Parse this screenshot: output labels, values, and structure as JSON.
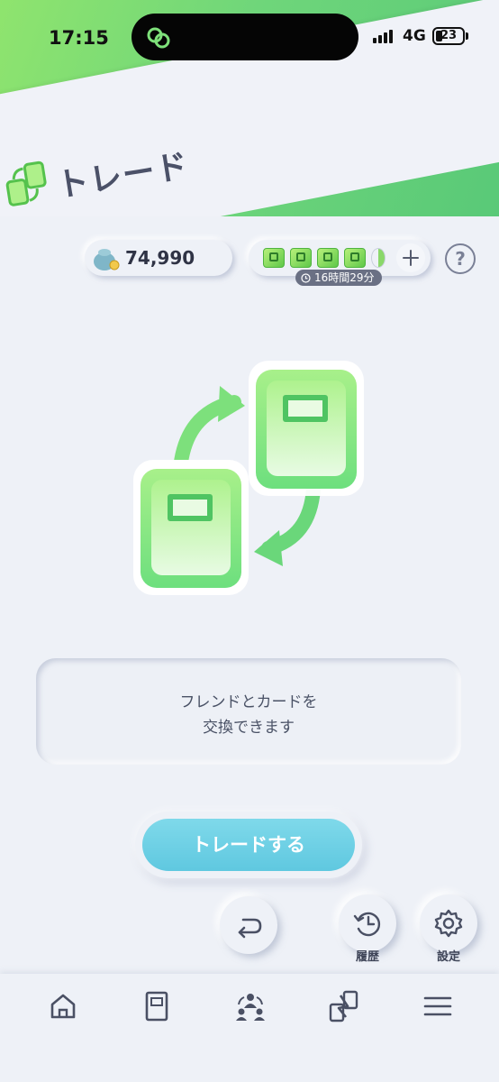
{
  "status_bar": {
    "time": "17:15",
    "network": "4G",
    "battery": "23"
  },
  "header": {
    "title": "トレード"
  },
  "currency": {
    "coins": "74,990",
    "stamina_timer": "16時間29分"
  },
  "help": {
    "label": "?"
  },
  "message": {
    "line1": "フレンドとカードを",
    "line2": "交換できます"
  },
  "actions": {
    "trade_label": "トレードする",
    "history_label": "履歴",
    "settings_label": "設定"
  },
  "colors": {
    "accent_green": "#6fd67a",
    "button_cyan": "#6dd0e6",
    "band_bg": "#f0f2f8"
  },
  "icons": {
    "nav": [
      "home-icon",
      "card-icon",
      "trade-icon",
      "battle-icon",
      "menu-icon"
    ],
    "actions": [
      "back-arrow-icon",
      "history-icon",
      "gear-icon"
    ]
  }
}
